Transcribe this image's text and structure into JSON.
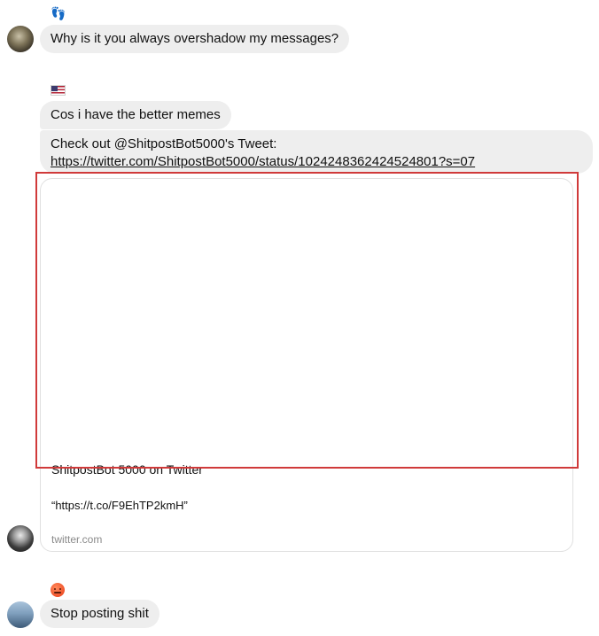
{
  "messages": [
    {
      "reaction_icon": "footprints-icon",
      "text": "Why is it you always overshadow my messages?"
    },
    {
      "reaction_icon": "us-flag-icon",
      "text": "Cos i have the better memes"
    },
    {
      "text_line": "Check out @ShitpostBot5000's Tweet:",
      "link": "https://twitter.com/ShitpostBot5000/status/1024248362424524801?s=07"
    },
    {
      "reaction_icon": "angry-face-icon",
      "text": "Stop posting shit"
    }
  ],
  "link_preview": {
    "title": "ShitpostBot 5000 on Twitter",
    "description": "“https://t.co/F9EhTP2kmH”",
    "domain": "twitter.com"
  },
  "colors": {
    "bubble_background": "#eeeeee",
    "highlight_border": "#d03a3a",
    "domain_text": "#8a8a8a"
  }
}
